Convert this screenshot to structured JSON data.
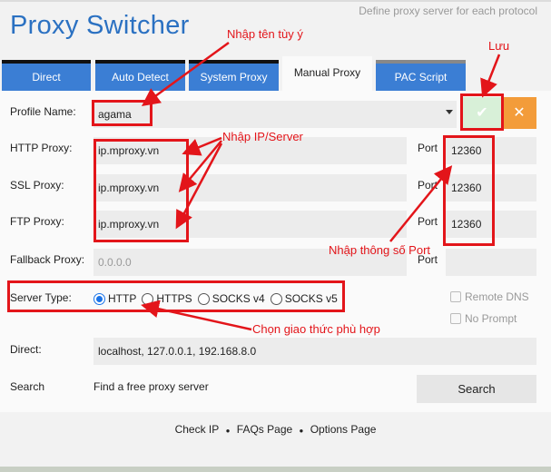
{
  "header": {
    "title": "Proxy Switcher",
    "subtitle": "Define proxy server for each protocol"
  },
  "tabs": [
    {
      "label": "Direct",
      "active": false
    },
    {
      "label": "Auto Detect",
      "active": false
    },
    {
      "label": "System Proxy",
      "active": false
    },
    {
      "label": "Manual Proxy",
      "active": true
    },
    {
      "label": "PAC Script",
      "active": false
    }
  ],
  "form": {
    "profile_label": "Profile Name:",
    "profile_value": "agama",
    "http_label": "HTTP Proxy:",
    "http_value": "ip.mproxy.vn",
    "ssl_label": "SSL Proxy:",
    "ssl_value": "ip.mproxy.vn",
    "ftp_label": "FTP Proxy:",
    "ftp_value": "ip.mproxy.vn",
    "fallback_label": "Fallback Proxy:",
    "fallback_placeholder": "0.0.0.0",
    "port_label": "Port",
    "http_port": "12360",
    "ssl_port": "12360",
    "ftp_port": "12360",
    "fallback_port": "",
    "server_type_label": "Server Type:",
    "server_types": [
      "HTTP",
      "HTTPS",
      "SOCKS v4",
      "SOCKS v5"
    ],
    "server_type_selected": "HTTP",
    "remote_dns_label": "Remote DNS",
    "no_prompt_label": "No Prompt",
    "direct_label": "Direct:",
    "direct_value": "localhost, 127.0.0.1, 192.168.8.0",
    "search_label": "Search",
    "search_text": "Find a free proxy server",
    "search_button": "Search",
    "save_icon": "check-icon",
    "delete_icon": "close-icon"
  },
  "footer": {
    "check_ip": "Check IP",
    "faqs": "FAQs Page",
    "options": "Options Page",
    "separator": "●"
  },
  "annotations": {
    "name_hint": "Nhập tên tùy ý",
    "save_hint": "Lưu",
    "ip_hint": "Nhập IP/Server",
    "port_hint": "Nhập thông số Port",
    "protocol_hint": "Chọn giao thức phù hợp"
  },
  "colors": {
    "title": "#2b71c2",
    "tab": "#3b7ed4",
    "save": "#d8f0d8",
    "delete": "#f39c3a",
    "annotation": "#e3151a"
  }
}
